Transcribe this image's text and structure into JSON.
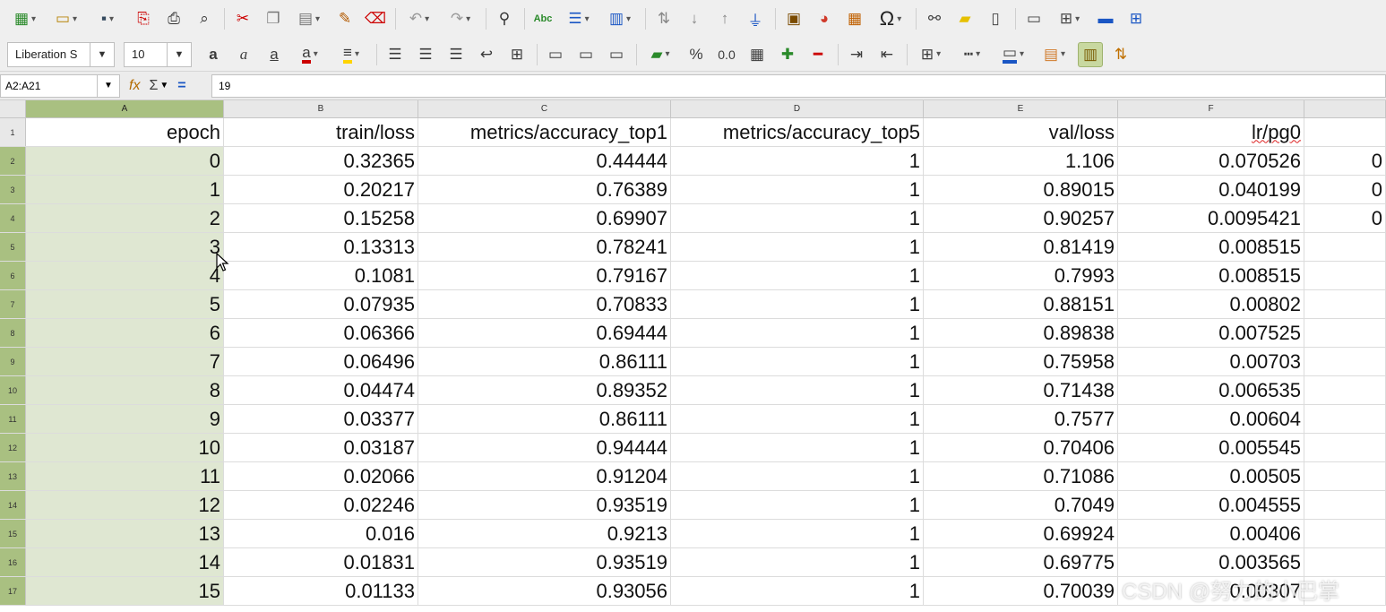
{
  "toolbar_row1": {
    "icons": [
      "new-icon",
      "open-icon",
      "save-icon",
      "export-pdf-icon",
      "print-icon",
      "print-preview-icon",
      "cut-icon",
      "copy-icon",
      "paste-icon",
      "clone-formatting-icon",
      "clear-formatting-icon",
      "undo-icon",
      "redo-icon",
      "find-replace-icon",
      "spelling-icon",
      "row-icon",
      "column-icon",
      "sort-icon",
      "sort-ascending-icon",
      "sort-descending-icon",
      "autofilter-icon",
      "image-icon",
      "chart-icon",
      "pivot-table-icon",
      "special-character-icon",
      "hyperlink-icon",
      "comment-icon",
      "headers-footers-icon",
      "define-print-area-icon",
      "freeze-rows-columns-icon",
      "split-window-icon",
      "show-grid-icon"
    ],
    "special_char_glyph": "Ω",
    "spelling_glyph": "Abc"
  },
  "toolbar_row2": {
    "font_name": "Liberation S",
    "font_size": "10",
    "percent_glyph": "%",
    "decimal_glyph": "0.0"
  },
  "formula_bar": {
    "name_box": "A2:A21",
    "function_glyph": "fx",
    "sum_glyph": "Σ",
    "equals_glyph": "=",
    "content": "19"
  },
  "sheet": {
    "selected_column": "A",
    "selected_range": "A2:A21",
    "column_letters": [
      "A",
      "B",
      "C",
      "D",
      "E",
      "F"
    ],
    "headers": [
      "epoch",
      "train/loss",
      "metrics/accuracy_top1",
      "metrics/accuracy_top5",
      "val/loss",
      "lr/pg0"
    ],
    "row_numbers": [
      "1",
      "2",
      "3",
      "4",
      "5",
      "6",
      "7",
      "8",
      "9",
      "10",
      "11",
      "12",
      "13",
      "14",
      "15",
      "16",
      "17"
    ],
    "rows": [
      [
        "0",
        "0.32365",
        "0.44444",
        "1",
        "1.106",
        "0.070526",
        "0"
      ],
      [
        "1",
        "0.20217",
        "0.76389",
        "1",
        "0.89015",
        "0.040199",
        "0"
      ],
      [
        "2",
        "0.15258",
        "0.69907",
        "1",
        "0.90257",
        "0.0095421",
        "0"
      ],
      [
        "3",
        "0.13313",
        "0.78241",
        "1",
        "0.81419",
        "0.008515",
        ""
      ],
      [
        "4",
        "0.1081",
        "0.79167",
        "1",
        "0.7993",
        "0.008515",
        ""
      ],
      [
        "5",
        "0.07935",
        "0.70833",
        "1",
        "0.88151",
        "0.00802",
        ""
      ],
      [
        "6",
        "0.06366",
        "0.69444",
        "1",
        "0.89838",
        "0.007525",
        ""
      ],
      [
        "7",
        "0.06496",
        "0.86111",
        "1",
        "0.75958",
        "0.00703",
        ""
      ],
      [
        "8",
        "0.04474",
        "0.89352",
        "1",
        "0.71438",
        "0.006535",
        ""
      ],
      [
        "9",
        "0.03377",
        "0.86111",
        "1",
        "0.7577",
        "0.00604",
        ""
      ],
      [
        "10",
        "0.03187",
        "0.94444",
        "1",
        "0.70406",
        "0.005545",
        ""
      ],
      [
        "11",
        "0.02066",
        "0.91204",
        "1",
        "0.71086",
        "0.00505",
        ""
      ],
      [
        "12",
        "0.02246",
        "0.93519",
        "1",
        "0.7049",
        "0.004555",
        ""
      ],
      [
        "13",
        "0.016",
        "0.9213",
        "1",
        "0.69924",
        "0.00406",
        ""
      ],
      [
        "14",
        "0.01831",
        "0.93519",
        "1",
        "0.69775",
        "0.003565",
        ""
      ],
      [
        "15",
        "0.01133",
        "0.93056",
        "1",
        "0.70039",
        "0.00307",
        ""
      ]
    ]
  },
  "watermark": "CSDN @努力的小巴掌",
  "colors": {
    "selection_header": "#a9c081",
    "selection_cells": "#dfe7d2",
    "toolbar_bg": "#efefef"
  }
}
